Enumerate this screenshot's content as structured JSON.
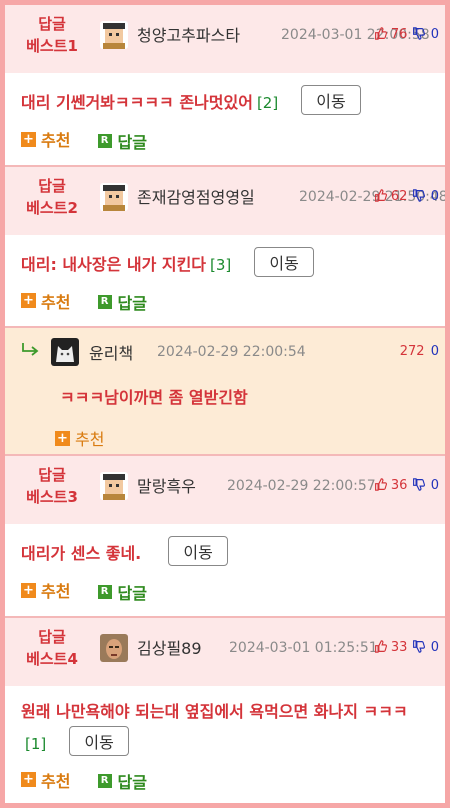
{
  "posts": [
    {
      "best_line1": "답글",
      "best_line2": "베스트1",
      "user": "청양고추파스타",
      "date": "2024-03-01 22:00:58",
      "up": "76",
      "down": "0",
      "title": "대리 기쎈거봐ㅋㅋㅋㅋ 존나멋있어",
      "count": "[2]",
      "move": "이동",
      "recommend": "추천",
      "reply": "답글"
    },
    {
      "best_line1": "답글",
      "best_line2": "베스트2",
      "user": "존재감영점영영일",
      "date": "2024-02-29 21:50:48",
      "up": "62",
      "down": "0",
      "title": "대리: 내사장은 내가 지킨다",
      "count": "[3]",
      "move": "이동",
      "recommend": "추천",
      "reply": "답글"
    },
    {
      "best_line1": "답글",
      "best_line2": "베스트3",
      "user": "말랑흑우",
      "date": "2024-02-29 22:00:57",
      "up": "36",
      "down": "0",
      "title": "대리가 센스 좋네.",
      "count": "",
      "move": "이동",
      "recommend": "추천",
      "reply": "답글"
    },
    {
      "best_line1": "답글",
      "best_line2": "베스트4",
      "user": "김상필89",
      "date": "2024-03-01 01:25:51",
      "up": "33",
      "down": "0",
      "title": "원래 나만욕해야 되는대 옆집에서 욕먹으면 화나지 ㅋㅋㅋ",
      "count": "[1]",
      "move": "이동",
      "recommend": "추천",
      "reply": "답글"
    }
  ],
  "reply_item": {
    "user": "윤리책",
    "date": "2024-02-29 22:00:54",
    "up": "272",
    "down": "0",
    "text": "ㅋㅋㅋ남이까면 좀 열받긴함",
    "recommend": "추천"
  },
  "colors": {
    "accent": "#d4343a",
    "best_bg": "#fde8e8",
    "reply_bg": "#fdebd6",
    "border": "#f6a7a7"
  },
  "icons": [
    "pixel-avatar-icon",
    "thumbs-up-icon",
    "thumbs-down-icon",
    "plus-icon",
    "r-reply-icon",
    "reply-arrow-icon"
  ]
}
